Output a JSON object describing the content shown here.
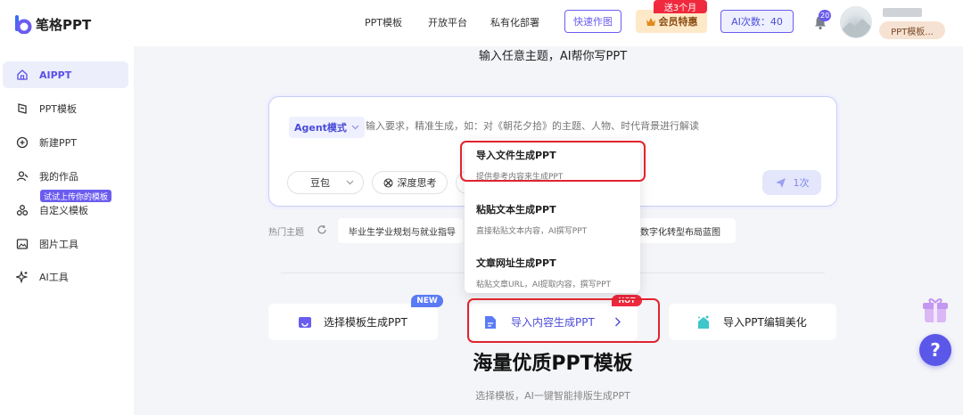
{
  "header": {
    "logo_text": "笔格PPT",
    "nav": [
      "PPT模板",
      "开放平台",
      "私有化部署"
    ],
    "quick_draw": "快速作图",
    "member_label": "会员特惠",
    "promo_badge": "送3个月",
    "ai_count": "AI次数：40",
    "bell_count": "20",
    "user_tag": "PPT模板..."
  },
  "sidebar": {
    "items": [
      {
        "label": "AIPPT",
        "icon": "home-icon"
      },
      {
        "label": "PPT模板",
        "icon": "template-icon"
      },
      {
        "label": "新建PPT",
        "icon": "plus-circle-icon"
      },
      {
        "label": "我的作品",
        "icon": "user-work-icon"
      },
      {
        "label": "自定义模板",
        "icon": "custom-template-icon"
      },
      {
        "label": "图片工具",
        "icon": "image-icon"
      },
      {
        "label": "AI工具",
        "icon": "sparkle-icon"
      }
    ],
    "try_tag": "试试上传你的模板"
  },
  "main": {
    "title": "输入任意主题，AI帮你写PPT",
    "agent_mode": "Agent模式",
    "input_placeholder": "输入要求，精准生成，如：对《朝花夕拾》的主题、人物、时代背景进行解读",
    "model": "豆包",
    "deep_think": "深度思考",
    "send_label": "1次",
    "hot_label": "热门主题",
    "chips": [
      "毕业生学业规划与就业指导",
      "数字化转型布局蓝图"
    ],
    "features": [
      {
        "label": "选择模板生成PPT",
        "badge": "NEW"
      },
      {
        "label": "导入内容生成PPT",
        "badge": "HOT"
      },
      {
        "label": "导入PPT编辑美化"
      }
    ],
    "section_title": "海量优质PPT模板",
    "section_subtitle": "选择模板，AI一键智能排版生成PPT"
  },
  "dropdown": {
    "items": [
      {
        "title": "导入文件生成PPT",
        "desc": "提供参考内容来生成PPT"
      },
      {
        "title": "粘贴文本生成PPT",
        "desc": "直接粘贴文本内容，AI撰写PPT"
      },
      {
        "title": "文章网址生成PPT",
        "desc": "粘贴文章URL，AI提取内容，撰写PPT"
      }
    ]
  },
  "colors": {
    "accent": "#6b5cf0",
    "highlight": "#e0242e",
    "hot": "#f0293e"
  }
}
